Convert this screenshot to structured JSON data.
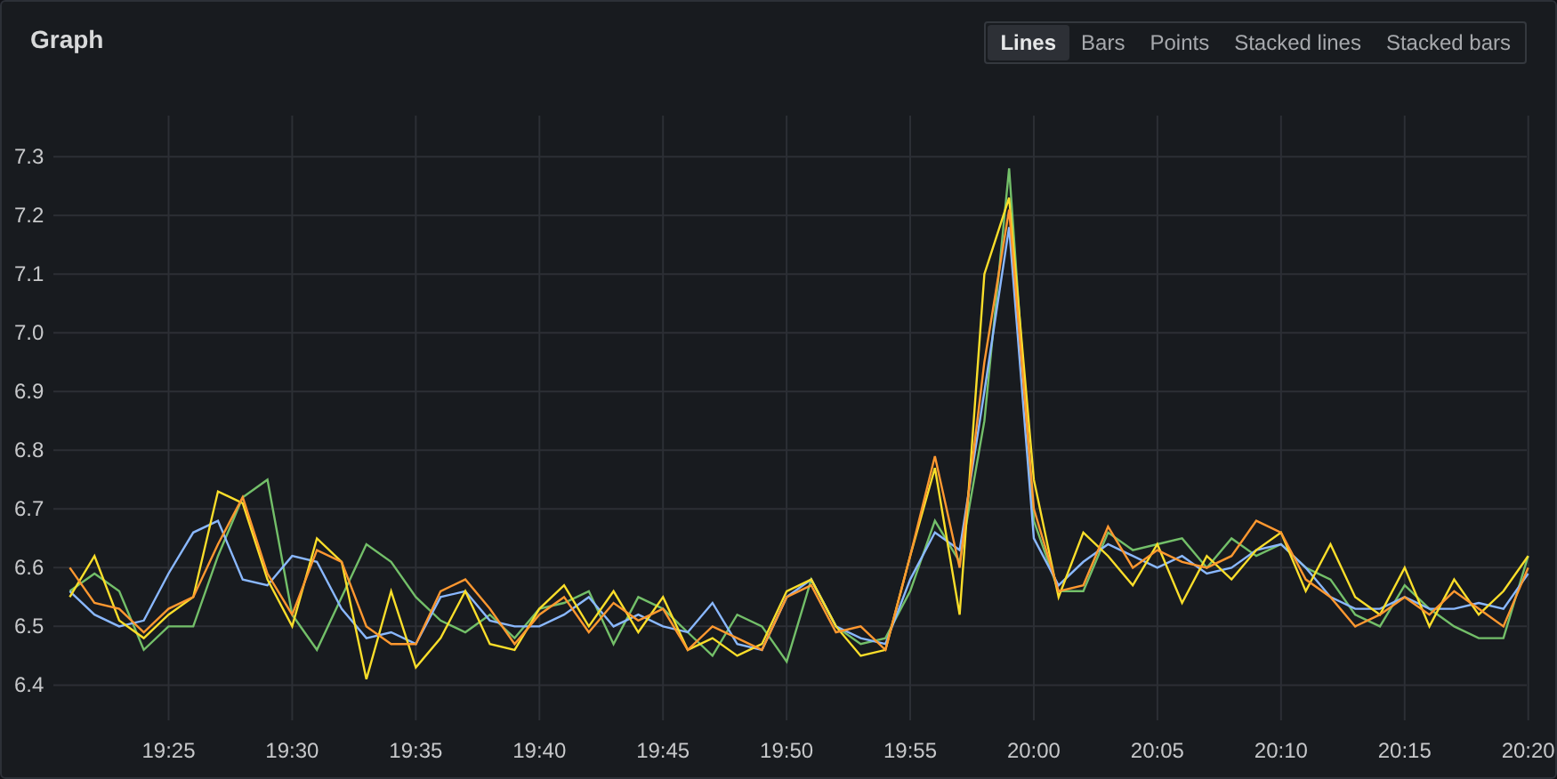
{
  "panel": {
    "title": "Graph",
    "view_options": [
      {
        "label": "Lines",
        "selected": true
      },
      {
        "label": "Bars",
        "selected": false
      },
      {
        "label": "Points",
        "selected": false
      },
      {
        "label": "Stacked lines",
        "selected": false
      },
      {
        "label": "Stacked bars",
        "selected": false
      }
    ],
    "chart_data": {
      "type": "line",
      "categories": [
        null,
        null,
        null,
        null,
        "19:25",
        null,
        null,
        null,
        null,
        "19:30",
        null,
        null,
        null,
        null,
        "19:35",
        null,
        null,
        null,
        null,
        "19:40",
        null,
        null,
        null,
        null,
        "19:45",
        null,
        null,
        null,
        null,
        "19:50",
        null,
        null,
        null,
        null,
        "19:55",
        null,
        null,
        null,
        null,
        "20:00",
        null,
        null,
        null,
        null,
        "20:05",
        null,
        null,
        null,
        null,
        "20:10",
        null,
        null,
        null,
        null,
        "20:15",
        null,
        null,
        null,
        null,
        "20:20"
      ],
      "ylim": [
        6.34,
        7.37
      ],
      "grid": true,
      "yticks": [
        {
          "value": 6.4,
          "label": "6.4"
        },
        {
          "value": 6.5,
          "label": "6.5"
        },
        {
          "value": 6.6,
          "label": "6.6"
        },
        {
          "value": 6.7,
          "label": "6.7"
        },
        {
          "value": 6.8,
          "label": "6.8"
        },
        {
          "value": 6.9,
          "label": "6.9"
        },
        {
          "value": 7.0,
          "label": "7.0"
        },
        {
          "value": 7.1,
          "label": "7.1"
        },
        {
          "value": 7.2,
          "label": "7.2"
        },
        {
          "value": 7.3,
          "label": "7.3"
        }
      ],
      "series": [
        {
          "color": "#73bf69",
          "values": [
            6.56,
            6.59,
            6.56,
            6.46,
            6.5,
            6.5,
            6.62,
            6.72,
            6.75,
            6.52,
            6.46,
            6.55,
            6.64,
            6.61,
            6.55,
            6.51,
            6.49,
            6.52,
            6.48,
            6.53,
            6.54,
            6.56,
            6.47,
            6.55,
            6.53,
            6.49,
            6.45,
            6.52,
            6.5,
            6.44,
            6.58,
            6.5,
            6.47,
            6.48,
            6.56,
            6.68,
            6.61,
            6.85,
            7.28,
            6.68,
            6.56,
            6.56,
            6.66,
            6.63,
            6.64,
            6.65,
            6.6,
            6.65,
            6.62,
            6.64,
            6.6,
            6.58,
            6.52,
            6.5,
            6.57,
            6.53,
            6.5,
            6.48,
            6.48,
            6.62
          ]
        },
        {
          "color": "#8ab8ff",
          "values": [
            6.56,
            6.52,
            6.5,
            6.51,
            6.59,
            6.66,
            6.68,
            6.58,
            6.57,
            6.62,
            6.61,
            6.53,
            6.48,
            6.49,
            6.47,
            6.55,
            6.56,
            6.51,
            6.5,
            6.5,
            6.52,
            6.55,
            6.5,
            6.52,
            6.5,
            6.49,
            6.54,
            6.47,
            6.46,
            6.55,
            6.58,
            6.5,
            6.48,
            6.47,
            6.58,
            6.66,
            6.63,
            6.9,
            7.18,
            6.65,
            6.57,
            6.61,
            6.64,
            6.62,
            6.6,
            6.62,
            6.59,
            6.6,
            6.63,
            6.64,
            6.6,
            6.55,
            6.53,
            6.53,
            6.55,
            6.53,
            6.53,
            6.54,
            6.53,
            6.59
          ]
        },
        {
          "color": "#fade2a",
          "values": [
            6.55,
            6.62,
            6.51,
            6.48,
            6.52,
            6.55,
            6.73,
            6.71,
            6.58,
            6.5,
            6.65,
            6.61,
            6.41,
            6.56,
            6.43,
            6.48,
            6.56,
            6.47,
            6.46,
            6.53,
            6.57,
            6.5,
            6.56,
            6.49,
            6.55,
            6.46,
            6.48,
            6.45,
            6.47,
            6.56,
            6.58,
            6.5,
            6.45,
            6.46,
            6.62,
            6.77,
            6.52,
            7.1,
            7.23,
            6.75,
            6.55,
            6.66,
            6.62,
            6.57,
            6.64,
            6.54,
            6.62,
            6.58,
            6.63,
            6.66,
            6.56,
            6.64,
            6.55,
            6.52,
            6.6,
            6.5,
            6.58,
            6.52,
            6.56,
            6.62
          ]
        },
        {
          "color": "#ff9830",
          "values": [
            6.6,
            6.54,
            6.53,
            6.49,
            6.53,
            6.55,
            6.64,
            6.72,
            6.59,
            6.52,
            6.63,
            6.61,
            6.5,
            6.47,
            6.47,
            6.56,
            6.58,
            6.53,
            6.47,
            6.52,
            6.55,
            6.49,
            6.54,
            6.51,
            6.53,
            6.46,
            6.5,
            6.48,
            6.46,
            6.55,
            6.57,
            6.49,
            6.5,
            6.46,
            6.62,
            6.79,
            6.6,
            6.95,
            7.21,
            6.7,
            6.56,
            6.57,
            6.67,
            6.6,
            6.63,
            6.61,
            6.6,
            6.62,
            6.68,
            6.66,
            6.58,
            6.55,
            6.5,
            6.52,
            6.55,
            6.52,
            6.56,
            6.53,
            6.5,
            6.6
          ]
        }
      ]
    }
  }
}
